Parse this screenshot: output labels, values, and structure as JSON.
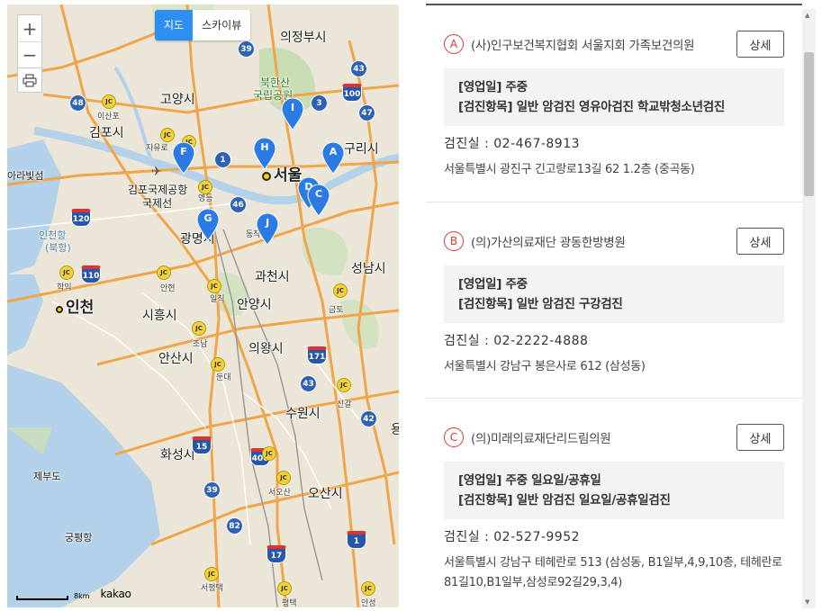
{
  "map": {
    "type_buttons": [
      {
        "label": "지도",
        "active": true
      },
      {
        "label": "스카이뷰",
        "active": false
      }
    ],
    "zoom_in": "+",
    "zoom_out": "−",
    "labels": {
      "uijeongbu": "의정부시",
      "goyang": "고양시",
      "bukhansan": "북한산",
      "national_park": "국립공원",
      "guri": "구리시",
      "gimpo": "김포시",
      "seoul": "서울",
      "gimpo_airport": "김포국제공항",
      "domestic": "국제선",
      "gwangmyeong": "광명시",
      "seongnam": "성남시",
      "gwacheon": "과천시",
      "incheon": "인천",
      "siheung": "시흥시",
      "anyang": "안양시",
      "uiwang": "의왕시",
      "ansan": "안산시",
      "suwon": "수원시",
      "hwaseong": "화성시",
      "osan": "오산시",
      "jebudo": "제부도",
      "gungpyeong": "궁평항",
      "incheon_port": "인천항",
      "north_port": "(북항)",
      "arabit": "아라빛섬",
      "isanpo": "이산포",
      "jayuro": "자유로",
      "yeongdeungpo": "영등",
      "dongjak": "동작",
      "hakik": "학익",
      "anhyeon": "안현",
      "ilji": "일직",
      "jorn": "조남",
      "dundae": "둔대",
      "seoosan": "서오산",
      "seopyeongtaek": "서평택",
      "pyeongtaek": "평택",
      "singal": "신갈",
      "geumto": "금토",
      "anseong": "안성",
      "yong": "용"
    },
    "routes": [
      "39",
      "43",
      "100",
      "3",
      "47",
      "48",
      "1",
      "46",
      "120",
      "110",
      "171",
      "42",
      "15",
      "400",
      "39",
      "82",
      "17",
      "1",
      "43"
    ],
    "markers": [
      "A",
      "B",
      "C",
      "D",
      "F",
      "G",
      "H",
      "I",
      "J"
    ],
    "scale_distance": "8km",
    "logo": "kakao"
  },
  "clinics": [
    {
      "letter": "A",
      "name": "(사)인구보건복지협회 서울지회 가족보건의원",
      "detail_label": "상세",
      "hours": "[영업일] 주중",
      "checkups": "[검진항목] 일반 암검진 영유아검진 학교밖청소년검진",
      "phone": "검진실 :  02-467-8913",
      "address": "서울특별시 광진구 긴고랑로13길 62 1.2층 (중곡동)"
    },
    {
      "letter": "B",
      "name": "(의)가산의료재단 광동한방병원",
      "detail_label": "상세",
      "hours": "[영업일] 주중",
      "checkups": "[검진항목] 일반 암검진 구강검진",
      "phone": "검진실 :  02-2222-4888",
      "address": "서울특별시 강남구 봉은사로 612 (삼성동)"
    },
    {
      "letter": "C",
      "name": "(의)미래의료재단리드림의원",
      "detail_label": "상세",
      "hours": "[영업일] 주중 일요일/공휴일",
      "checkups": "[검진항목] 일반 암검진 일요일/공휴일검진",
      "phone": "검진실 :  02-527-9952",
      "address": "서울특별시 강남구 테헤란로 513 (삼성동, B1일부,4,9,10층, 테헤란로81길10,B1일부,삼성로92길29,3,4)"
    }
  ],
  "colors": {
    "accent": "#2d8ff0",
    "marker": "#2c7be5",
    "letter": "#d23b3b",
    "water": "#b3d1e8",
    "land": "#ebe6d8"
  }
}
